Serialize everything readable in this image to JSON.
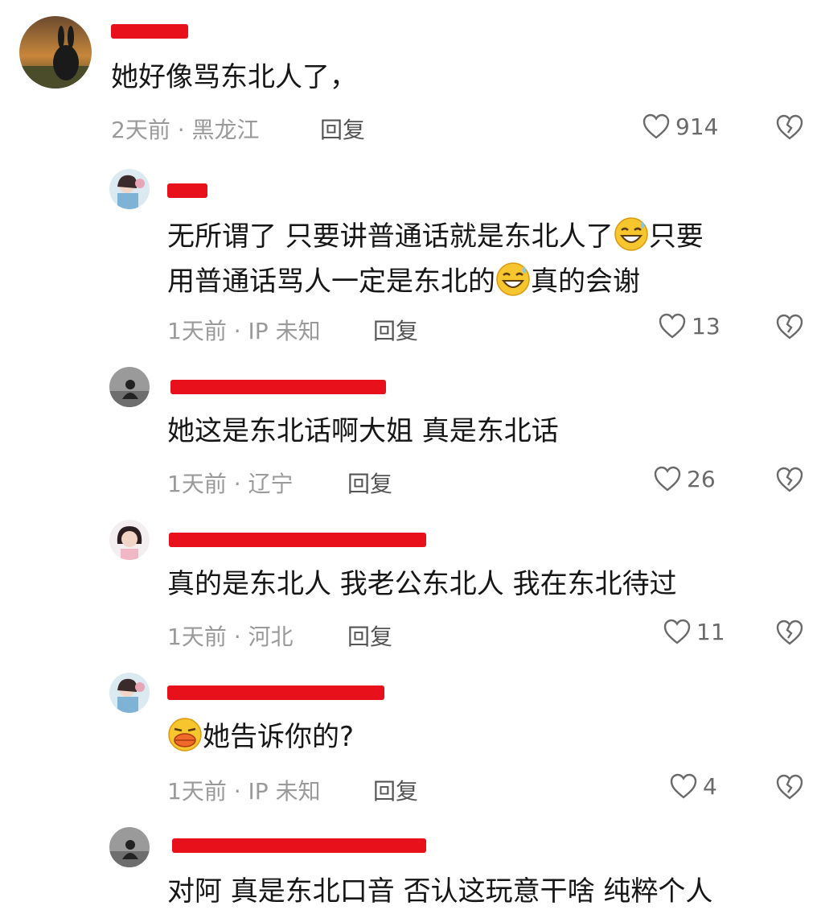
{
  "comments": [
    {
      "content": "她好像骂东北人了，",
      "time": "2天前",
      "location": "黑龙江",
      "reply_label": "回复",
      "likes": "914"
    },
    {
      "content_line1_a": "无所谓了 只要讲普通话就是东北人了",
      "content_line1_b": "只要",
      "content_line2_a": "用普通话骂人一定是东北的",
      "content_line2_b": "真的会谢",
      "time": "1天前",
      "location": "IP 未知",
      "reply_label": "回复",
      "likes": "13"
    },
    {
      "content": "她这是东北话啊大姐 真是东北话",
      "time": "1天前",
      "location": "辽宁",
      "reply_label": "回复",
      "likes": "26"
    },
    {
      "content": "真的是东北人  我老公东北人  我在东北待过",
      "time": "1天前",
      "location": "河北",
      "reply_label": "回复",
      "likes": "11"
    },
    {
      "content": "她告诉你的?",
      "time": "1天前",
      "location": "IP 未知",
      "reply_label": "回复",
      "likes": "4"
    },
    {
      "content": "对阿 真是东北口音 否认这玩意干啥 纯粹个人"
    }
  ],
  "separator": " · ",
  "colors": {
    "redaction": "#e8101a",
    "meta": "#9a9a9a",
    "text": "#161616"
  }
}
